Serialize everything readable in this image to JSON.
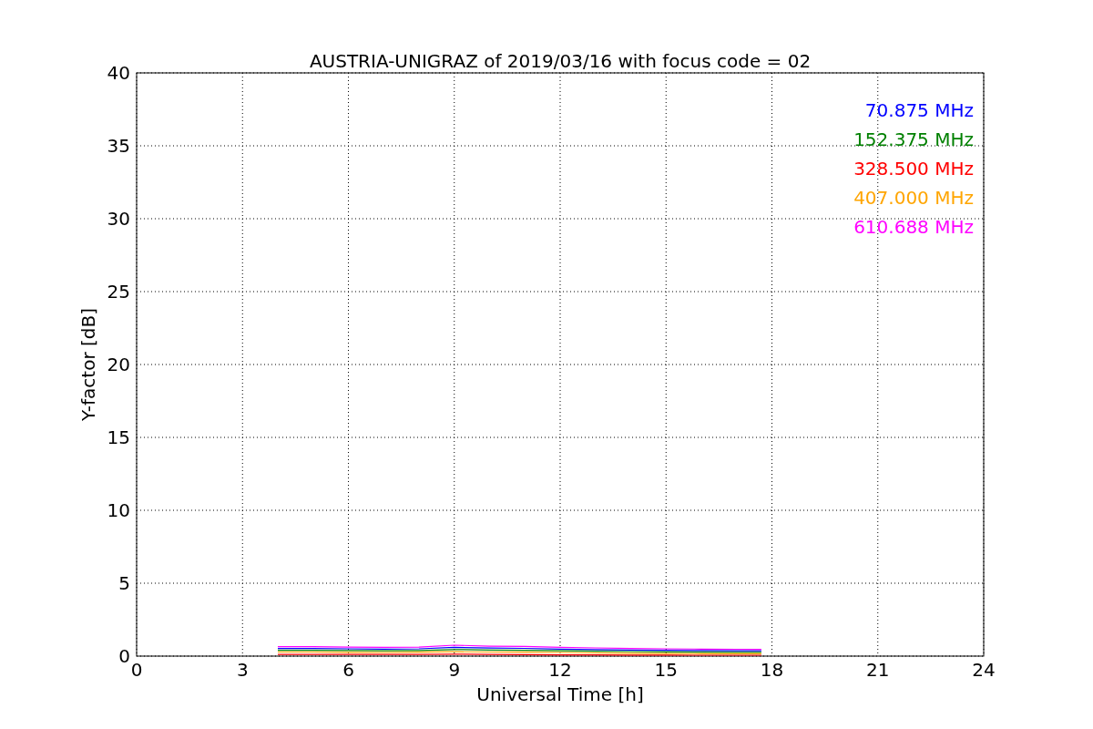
{
  "figure": {
    "chart_data": {
      "type": "line",
      "title": "AUSTRIA-UNIGRAZ of 2019/03/16 with focus code = 02",
      "xlabel": "Universal Time [h]",
      "ylabel": "Y-factor [dB]",
      "x": [
        4,
        5,
        6,
        7,
        8,
        9,
        10,
        11,
        12,
        13,
        14,
        15,
        16,
        17,
        17.7
      ],
      "series": [
        {
          "name": "70.875 MHz",
          "color": "#0000ff",
          "values": [
            0.52,
            0.52,
            0.5,
            0.48,
            0.5,
            0.6,
            0.55,
            0.53,
            0.48,
            0.45,
            0.42,
            0.4,
            0.38,
            0.37,
            0.36
          ]
        },
        {
          "name": "152.375 MHz",
          "color": "#008000",
          "values": [
            0.4,
            0.4,
            0.38,
            0.36,
            0.38,
            0.45,
            0.42,
            0.4,
            0.36,
            0.33,
            0.31,
            0.29,
            0.27,
            0.26,
            0.26
          ]
        },
        {
          "name": "328.500 MHz",
          "color": "#ff0000",
          "values": [
            0.12,
            0.12,
            0.12,
            0.11,
            0.12,
            0.13,
            0.12,
            0.1,
            0.09,
            0.08,
            0.07,
            0.07,
            0.06,
            0.06,
            0.06
          ]
        },
        {
          "name": "407.000 MHz",
          "color": "#ffa500",
          "values": [
            0.28,
            0.28,
            0.26,
            0.25,
            0.27,
            0.3,
            0.28,
            0.27,
            0.25,
            0.22,
            0.2,
            0.18,
            0.17,
            0.16,
            0.16
          ]
        },
        {
          "name": "610.688 MHz",
          "color": "#ff00ff",
          "values": [
            0.65,
            0.65,
            0.62,
            0.6,
            0.62,
            0.75,
            0.68,
            0.66,
            0.6,
            0.56,
            0.52,
            0.5,
            0.48,
            0.47,
            0.46
          ]
        }
      ],
      "grid": true,
      "xlim": [
        0,
        24
      ],
      "ylim": [
        0,
        40
      ],
      "xticks": [
        0,
        3,
        6,
        9,
        12,
        15,
        18,
        21,
        24
      ],
      "yticks": [
        0,
        5,
        10,
        15,
        20,
        25,
        30,
        35,
        40
      ]
    }
  }
}
